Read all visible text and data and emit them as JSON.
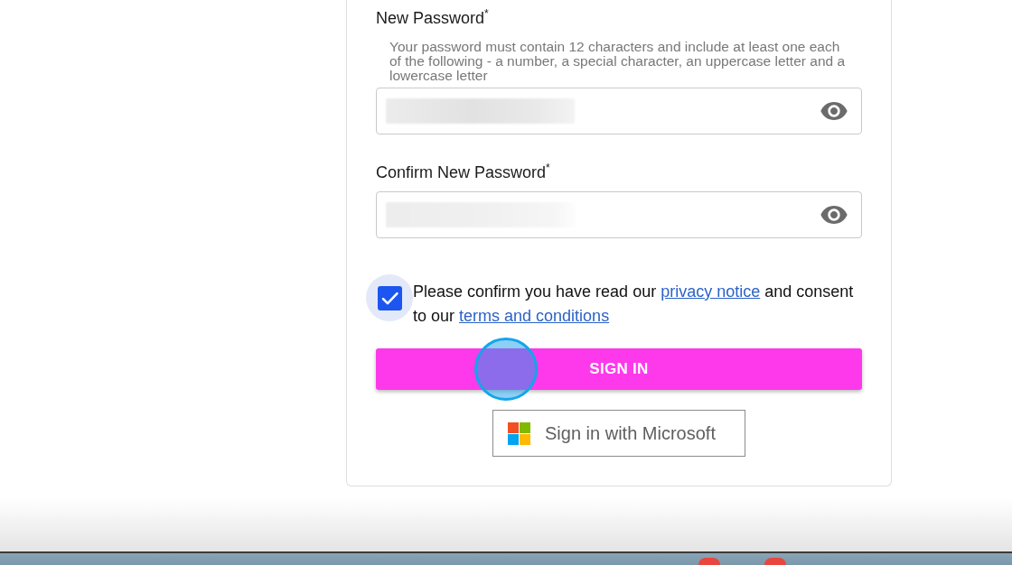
{
  "form": {
    "fields": [
      {
        "label": "New Password$^{*}$",
        "hint": "Your password must contain 12 characters and include at least one each of the following - a number, a special character, an uppercase letter and a lowercase letter",
        "value_blurred": true
      },
      {
        "label": "Confirm New Password$^{*}$",
        "value_blurred": true
      }
    ],
    "consent": {
      "checked": true,
      "parts": [
        {
          "kind": "text",
          "text": "Please confirm you have read our"
        },
        {
          "kind": "link",
          "text": "privacy notice"
        },
        {
          "kind": "text",
          "text": "and consent to our"
        },
        {
          "kind": "link",
          "text": "terms and conditions"
        }
      ]
    },
    "sign_in_button": {
      "label": "SIGN IN"
    },
    "microsoft_button": {
      "label": "Sign in with Microsoft"
    }
  }
}
